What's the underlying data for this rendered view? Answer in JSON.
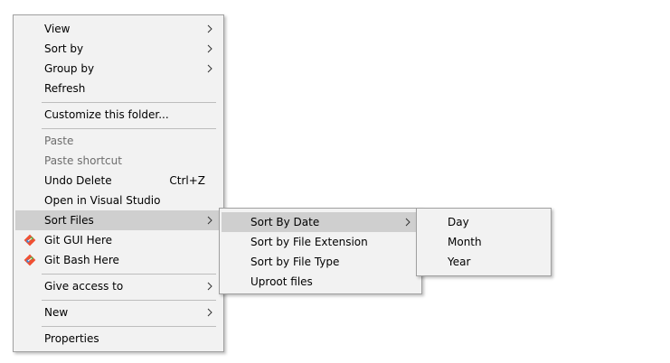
{
  "main_menu": {
    "view": "View",
    "sort_by": "Sort by",
    "group_by": "Group by",
    "refresh": "Refresh",
    "customize": "Customize this folder...",
    "paste": "Paste",
    "paste_shortcut": "Paste shortcut",
    "undo_delete": "Undo Delete",
    "undo_shortcut": "Ctrl+Z",
    "open_vs": "Open in Visual Studio",
    "sort_files": "Sort Files",
    "git_gui": "Git GUI Here",
    "git_bash": "Git Bash Here",
    "give_access": "Give access to",
    "new": "New",
    "properties": "Properties"
  },
  "sort_files_menu": {
    "by_date": "Sort By Date",
    "by_extension": "Sort by File Extension",
    "by_type": "Sort by File Type",
    "uproot": "Uproot files"
  },
  "date_menu": {
    "day": "Day",
    "month": "Month",
    "year": "Year"
  },
  "colors": {
    "menu_bg": "#f2f2f2",
    "highlight": "#cfcfcf",
    "disabled_text": "#6d6d6d",
    "git_red": "#f05033"
  }
}
